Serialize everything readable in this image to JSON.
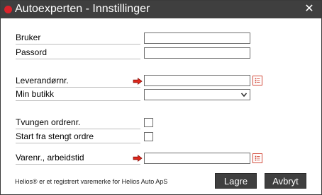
{
  "window": {
    "title": "Autoexperten - Innstillinger",
    "close_symbol": "✕"
  },
  "form": {
    "username": {
      "label": "Bruker",
      "value": ""
    },
    "password": {
      "label": "Passord",
      "value": ""
    },
    "supplier_no": {
      "label": "Leverandørnr.",
      "value": "",
      "icons": [
        "arrow-right-icon",
        "list-icon"
      ]
    },
    "my_store": {
      "label": "Min butikk",
      "selected": ""
    },
    "forced_order_no": {
      "label": "Tvungen ordrenr.",
      "checked": false
    },
    "start_from_closed_order": {
      "label": "Start fra stengt ordre",
      "checked": false
    },
    "item_no_work_time": {
      "label": "Varenr., arbeidstid",
      "value": "",
      "icons": [
        "arrow-right-icon",
        "list-icon"
      ]
    }
  },
  "footer": {
    "note": "Helios® er et registrert varemerke for Helios Auto ApS",
    "save_label": "Lagre",
    "cancel_label": "Avbryt"
  },
  "colors": {
    "titlebar": "#3f3f3f",
    "title_dot": "#d9232b",
    "arrow": "#e0271c",
    "list_icon": "#d24a3a"
  }
}
